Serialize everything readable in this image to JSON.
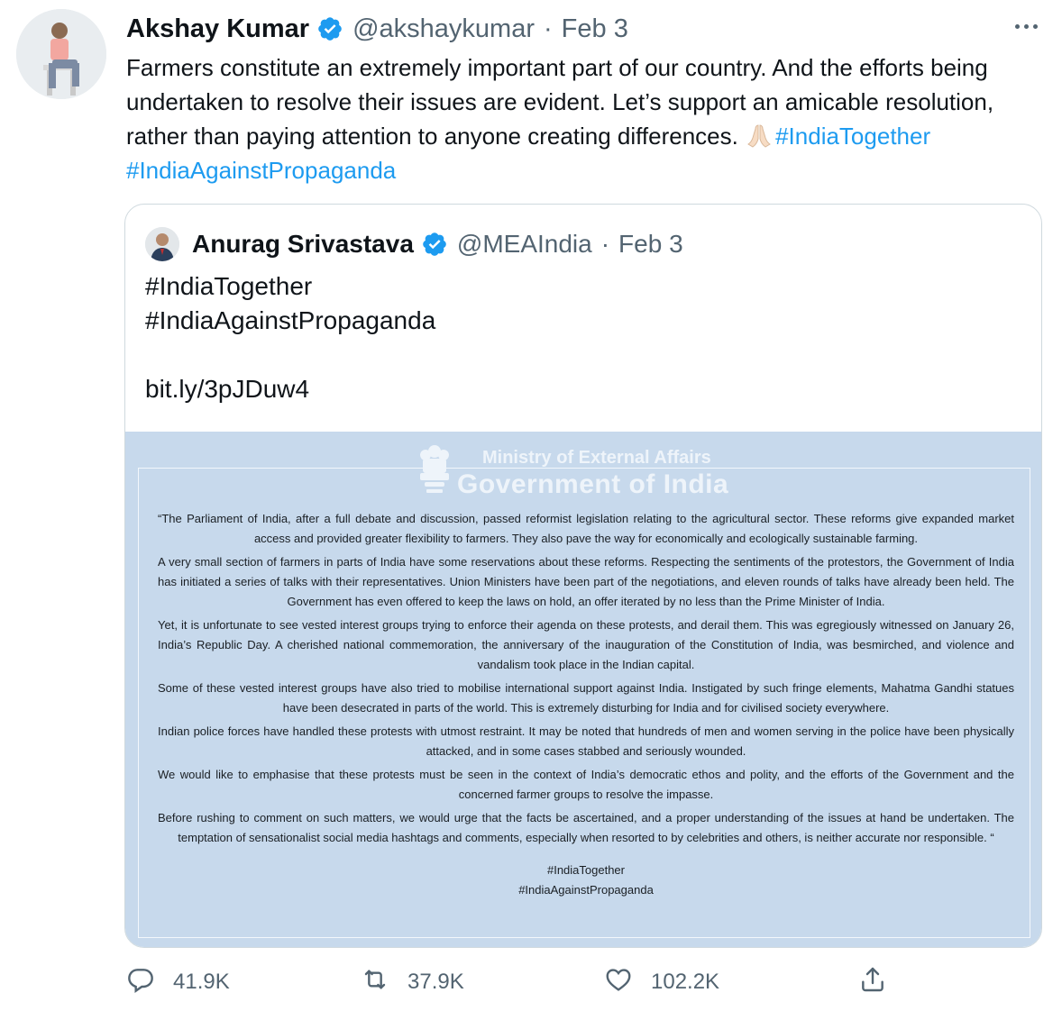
{
  "tweet": {
    "author_name": "Akshay Kumar",
    "handle": "@akshaykumar",
    "separator": "·",
    "date": "Feb 3",
    "text_plain": "Farmers constitute an extremely important part of our country. And the efforts being undertaken to resolve their issues are evident. Let’s support an amicable resolution, rather than paying attention to anyone creating differences. ",
    "hashtag1": "#IndiaTogether",
    "hashtag2": "#IndiaAgainstPropaganda"
  },
  "quote": {
    "author_name": "Anurag Srivastava",
    "handle": "@MEAIndia",
    "separator": "·",
    "date": "Feb 3",
    "line1": "#IndiaTogether",
    "line2": "#IndiaAgainstPropaganda",
    "link": "bit.ly/3pJDuw4",
    "document": {
      "ministry": "Ministry of External Affairs",
      "government": "Government of India",
      "paragraphs": [
        "“The Parliament of India, after a full debate and discussion, passed reformist legislation relating to the agricultural sector. These reforms give expanded market access and provided greater flexibility to farmers. They also pave the way for economically and ecologically sustainable farming.",
        "A very small section of farmers in parts of India have some reservations about these reforms. Respecting the sentiments of the protestors, the Government of India has initiated a series of talks with their representatives. Union Ministers have been part of the negotiations, and eleven rounds of talks have already been held. The Government has even offered to keep the laws on hold, an offer iterated by no less than the Prime Minister of India.",
        "Yet, it is unfortunate to see vested interest groups trying to enforce their agenda on these protests, and derail them. This was egregiously witnessed on January 26, India’s Republic Day. A cherished national commemoration, the anniversary of the inauguration of the Constitution of India, was besmirched, and violence and vandalism took place in the Indian capital.",
        "Some of these vested interest groups have also tried to mobilise international support against India. Instigated by such fringe elements, Mahatma Gandhi statues have been desecrated in parts of the world. This is extremely disturbing for India and for civilised society everywhere.",
        "Indian police forces have handled these protests with utmost restraint. It may be noted that hundreds of men and women serving in the police have been physically attacked, and in some cases stabbed and seriously wounded.",
        "We would like to emphasise that these protests must be seen in the context of India’s democratic ethos and polity, and the efforts of the Government and the concerned farmer groups to resolve the impasse.",
        "Before rushing to comment on such matters, we would urge that the facts be ascertained, and a proper understanding of the issues at hand be undertaken. The temptation of sensationalist social media hashtags and comments, especially when resorted to by celebrities and others, is neither accurate nor responsible. “"
      ],
      "tag1": "#IndiaTogether",
      "tag2": "#IndiaAgainstPropaganda"
    }
  },
  "actions": {
    "reply_count": "41.9K",
    "retweet_count": "37.9K",
    "like_count": "102.2K"
  },
  "icons": [
    "verified-badge-icon",
    "more-options-icon",
    "folded-hands-emoji-icon",
    "reply-icon",
    "retweet-icon",
    "like-icon",
    "share-icon",
    "national-emblem-icon"
  ],
  "colors": {
    "link": "#1d9bf0",
    "secondary_text": "#536471",
    "document_background": "#c7d9ec"
  }
}
